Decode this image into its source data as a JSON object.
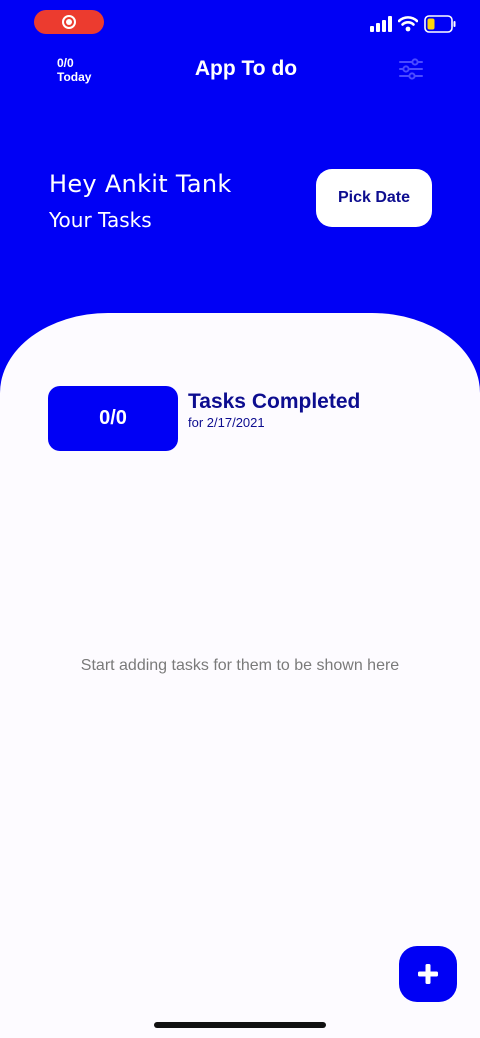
{
  "colors": {
    "brand_blue": "#0000f5",
    "dark_blue_text": "#0d0d8f",
    "sheet_background": "#fdfbff",
    "muted_text": "#7a7a7a",
    "record_red": "#ec3b2f"
  },
  "status_bar": {
    "record_icon": "screen-record-icon",
    "signal_icon": "cellular-signal-icon",
    "wifi_icon": "wifi-icon",
    "battery_icon": "battery-icon"
  },
  "header": {
    "today_count": "0/0",
    "today_label": "Today",
    "title": "App To do",
    "settings_icon": "sliders-icon"
  },
  "greeting": {
    "line1": "Hey Ankit Tank",
    "line2": "Your Tasks",
    "pick_date_label": "Pick Date"
  },
  "summary": {
    "progress": "0/0",
    "title": "Tasks Completed",
    "date": "for 2/17/2021"
  },
  "empty_state": {
    "message": "Start adding tasks for them to be shown here"
  },
  "fab": {
    "icon": "plus-icon"
  }
}
